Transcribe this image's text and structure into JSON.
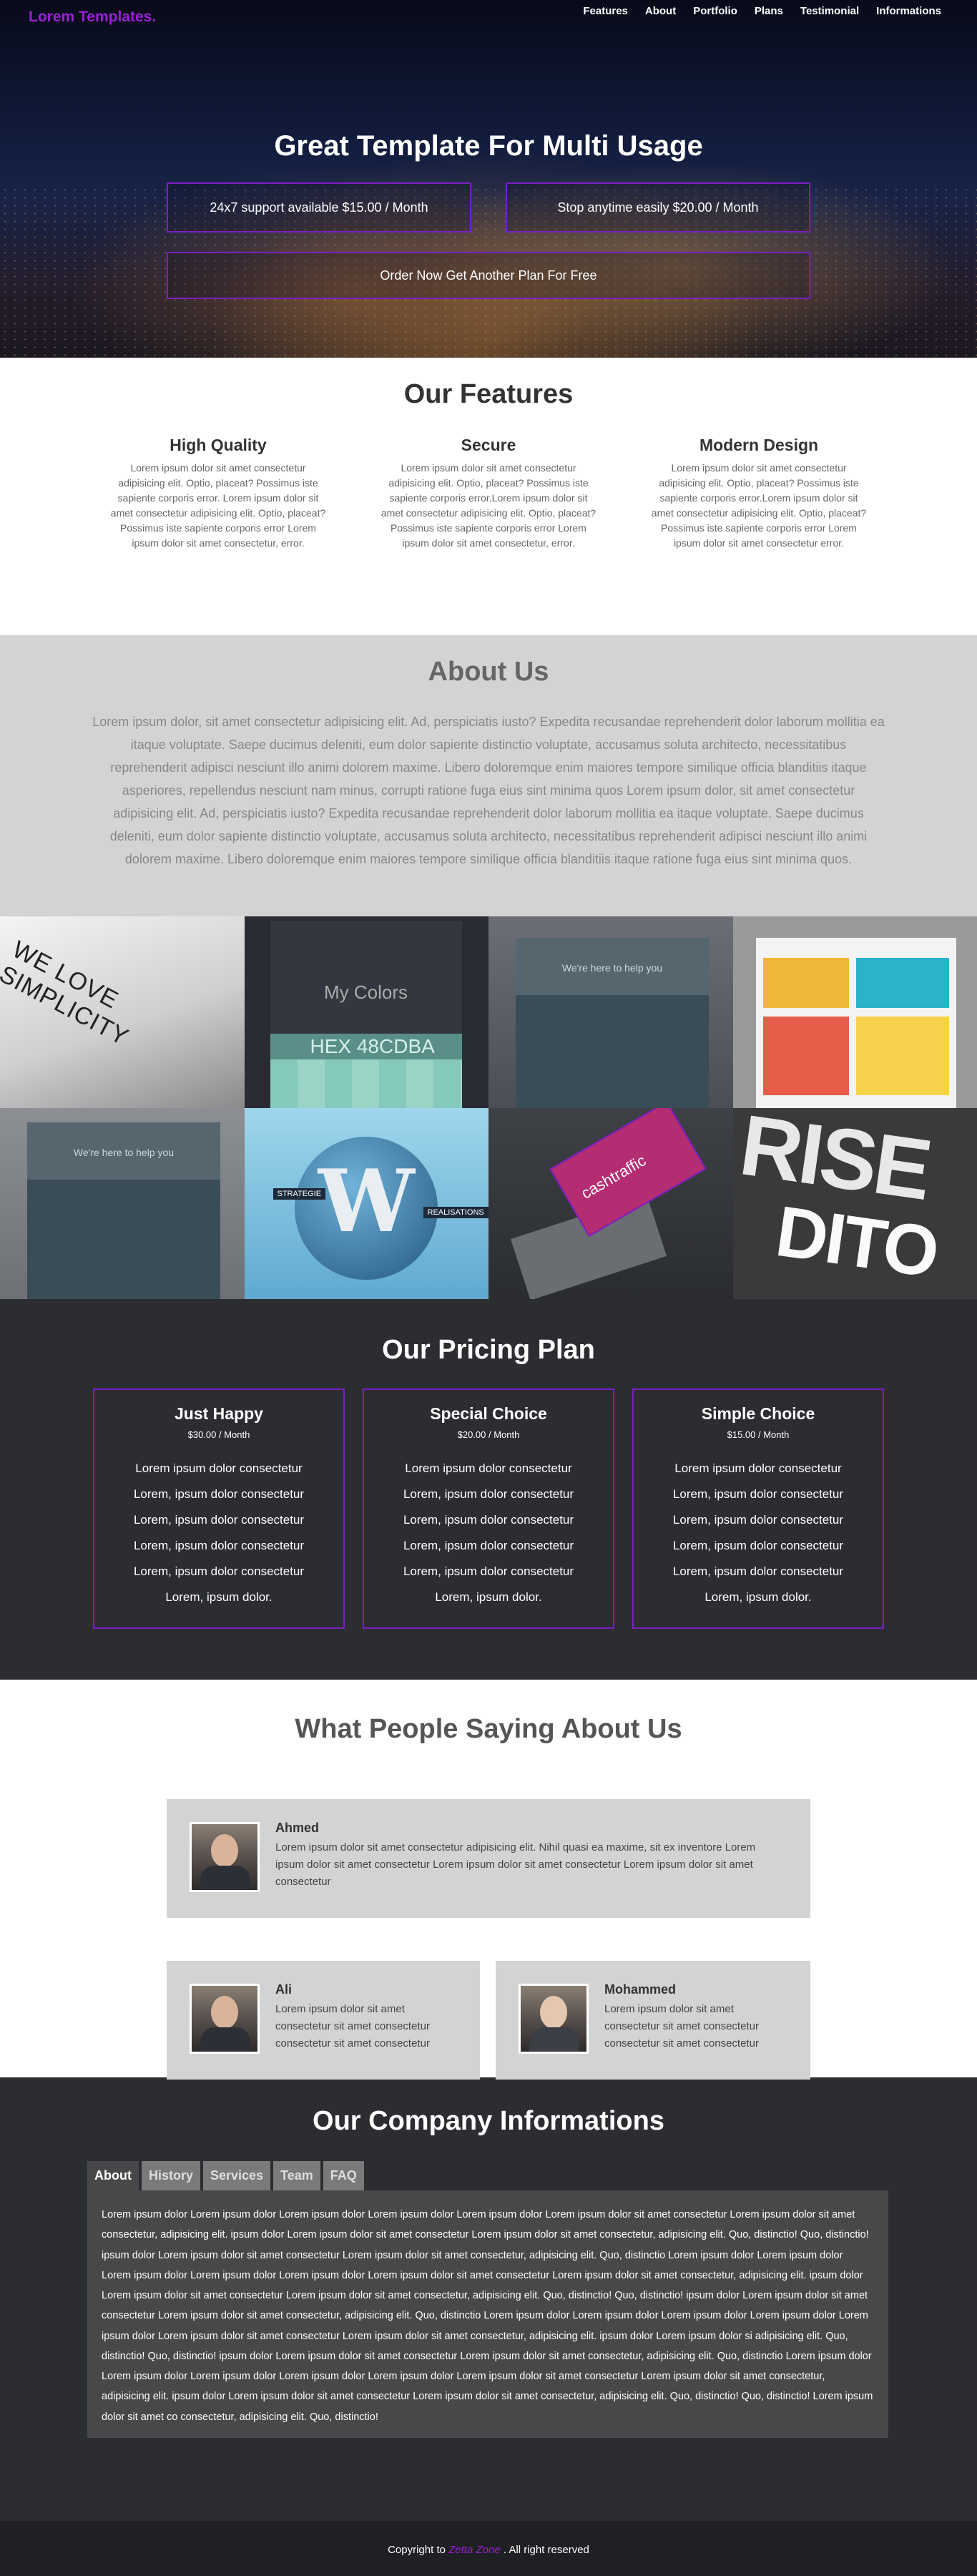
{
  "brand": "Lorem Templates.",
  "nav": [
    "Features",
    "About",
    "Portfolio",
    "Plans",
    "Testimonial",
    "Informations"
  ],
  "hero": {
    "title": "Great Template For Multi Usage",
    "plan1": "24x7 support available $15.00 / Month",
    "plan2": "Stop anytime easily $20.00 / Month",
    "plan3": "Order Now Get Another Plan For Free"
  },
  "features": {
    "title": "Our Features",
    "items": [
      {
        "title": "High Quality",
        "text": "Lorem ipsum dolor sit amet consectetur adipisicing elit. Optio, placeat? Possimus iste sapiente corporis error. Lorem ipsum dolor sit amet consectetur adipisicing elit. Optio, placeat? Possimus iste sapiente corporis error Lorem ipsum dolor sit amet consectetur, error."
      },
      {
        "title": "Secure",
        "text": "Lorem ipsum dolor sit amet consectetur adipisicing elit. Optio, placeat? Possimus iste sapiente corporis error.Lorem ipsum dolor sit amet consectetur adipisicing elit. Optio, placeat? Possimus iste sapiente corporis error Lorem ipsum dolor sit amet consectetur, error."
      },
      {
        "title": "Modern Design",
        "text": "Lorem ipsum dolor sit amet consectetur adipisicing elit. Optio, placeat? Possimus iste sapiente corporis error.Lorem ipsum dolor sit amet consectetur adipisicing elit. Optio, placeat? Possimus iste sapiente corporis error Lorem ipsum dolor sit amet consectetur error."
      }
    ]
  },
  "about": {
    "title": "About Us",
    "text": "Lorem ipsum dolor, sit amet consectetur adipisicing elit. Ad, perspiciatis iusto? Expedita recusandae reprehenderit dolor laborum mollitia ea itaque voluptate. Saepe ducimus deleniti, eum dolor sapiente distinctio voluptate, accusamus soluta architecto, necessitatibus reprehenderit adipisci nesciunt illo animi dolorem maxime. Libero doloremque enim maiores tempore similique officia blanditiis itaque asperiores, repellendus nesciunt nam minus, corrupti ratione fuga eius sint minima quos Lorem ipsum dolor, sit amet consectetur adipisicing elit. Ad, perspiciatis iusto? Expedita recusandae reprehenderit dolor laborum mollitia ea itaque voluptate. Saepe ducimus deleniti, eum dolor sapiente distinctio voluptate, accusamus soluta architecto, necessitatibus reprehenderit adipisci nesciunt illo animi dolorem maxime. Libero doloremque enim maiores tempore similique officia blanditiis itaque ratione fuga eius sint minima quos."
  },
  "gallery": {
    "t1": "WE LOVE SIMPLICITY",
    "t2_title": "My Colors",
    "t2_hex": "HEX 48CDBA",
    "t3": "We're here to help you",
    "t5": "We're here to help you",
    "t6_w": "W",
    "t6_a": "STRATEGIE",
    "t6_b": "REALISATIONS",
    "t7": "cashtraffic",
    "t8_a": "RISE",
    "t8_b": "DITO"
  },
  "pricing": {
    "title": "Our Pricing Plan",
    "cards": [
      {
        "name": "Just Happy",
        "price": "$30.00 / Month",
        "lines": [
          "Lorem ipsum dolor consectetur",
          "Lorem, ipsum dolor consectetur",
          "Lorem, ipsum dolor consectetur",
          "Lorem, ipsum dolor consectetur",
          "Lorem, ipsum dolor consectetur",
          "Lorem, ipsum dolor."
        ]
      },
      {
        "name": "Special Choice",
        "price": "$20.00 / Month",
        "lines": [
          "Lorem ipsum dolor consectetur",
          "Lorem, ipsum dolor consectetur",
          "Lorem, ipsum dolor consectetur",
          "Lorem, ipsum dolor consectetur",
          "Lorem, ipsum dolor consectetur",
          "Lorem, ipsum dolor."
        ]
      },
      {
        "name": "Simple Choice",
        "price": "$15.00 / Month",
        "lines": [
          "Lorem ipsum dolor consectetur",
          "Lorem, ipsum dolor consectetur",
          "Lorem, ipsum dolor consectetur",
          "Lorem, ipsum dolor consectetur",
          "Lorem, ipsum dolor consectetur",
          "Lorem, ipsum dolor."
        ]
      }
    ]
  },
  "testimonials": {
    "title": "What People Saying About Us",
    "items": [
      {
        "name": "Ahmed",
        "text": "Lorem ipsum dolor sit amet consectetur adipisicing elit. Nihil quasi ea maxime, sit ex inventore Lorem ipsum dolor sit amet consectetur Lorem ipsum dolor sit amet consectetur Lorem ipsum dolor sit amet consectetur"
      },
      {
        "name": "Ali",
        "text": "Lorem ipsum dolor sit amet consectetur sit amet consectetur consectetur sit amet consectetur"
      },
      {
        "name": "Mohammed",
        "text": "Lorem ipsum dolor sit amet consectetur sit amet consectetur consectetur sit amet consectetur"
      }
    ]
  },
  "company": {
    "title": "Our Company Informations",
    "tabs": [
      "About",
      "History",
      "Services",
      "Team",
      "FAQ"
    ],
    "active_tab": "About",
    "text": "Lorem ipsum dolor Lorem ipsum dolor Lorem ipsum dolor Lorem ipsum dolor Lorem ipsum dolor Lorem ipsum dolor sit amet consectetur Lorem ipsum dolor sit amet consectetur, adipisicing elit. ipsum dolor Lorem ipsum dolor sit amet consectetur Lorem ipsum dolor sit amet consectetur, adipisicing elit. Quo, distinctio! Quo, distinctio! ipsum dolor Lorem ipsum dolor sit amet consectetur Lorem ipsum dolor sit amet consectetur, adipisicing elit. Quo, distinctio Lorem ipsum dolor Lorem ipsum dolor Lorem ipsum dolor Lorem ipsum dolor Lorem ipsum dolor Lorem ipsum dolor sit amet consectetur Lorem ipsum dolor sit amet consectetur, adipisicing elit. ipsum dolor Lorem ipsum dolor sit amet consectetur Lorem ipsum dolor sit amet consectetur, adipisicing elit. Quo, distinctio! Quo, distinctio! ipsum dolor Lorem ipsum dolor sit amet consectetur Lorem ipsum dolor sit amet consectetur, adipisicing elit. Quo, distinctio Lorem ipsum dolor Lorem ipsum dolor Lorem ipsum dolor Lorem ipsum dolor Lorem ipsum dolor Lorem ipsum dolor sit amet consectetur Lorem ipsum dolor sit amet consectetur, adipisicing elit. ipsum dolor Lorem ipsum dolor si adipisicing elit. Quo, distinctio! Quo, distinctio! ipsum dolor Lorem ipsum dolor sit amet consectetur Lorem ipsum dolor sit amet consectetur, adipisicing elit. Quo, distinctio Lorem ipsum dolor Lorem ipsum dolor Lorem ipsum dolor Lorem ipsum dolor Lorem ipsum dolor Lorem ipsum dolor sit amet consectetur Lorem ipsum dolor sit amet consectetur, adipisicing elit. ipsum dolor Lorem ipsum dolor sit amet consectetur Lorem ipsum dolor sit amet consectetur, adipisicing elit. Quo, distinctio! Quo, distinctio! Lorem ipsum dolor sit amet co consectetur, adipisicing elit. Quo, distinctio!"
  },
  "footer": {
    "prefix": "Copyright to",
    "link": "Zetta Zone",
    "suffix": ". All right reserved"
  },
  "colors": {
    "accent": "#7b1fc2",
    "brand": "#9b1fd6",
    "dark": "#2b2d31",
    "light_gray": "#d3d3d3"
  }
}
